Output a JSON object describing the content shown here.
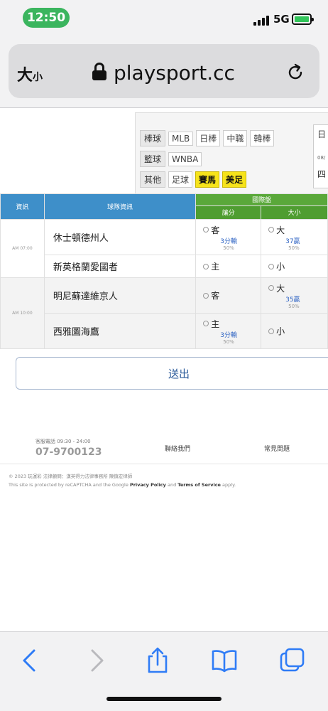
{
  "status": {
    "time": "12:50",
    "network": "5G"
  },
  "browser": {
    "text_size": "大",
    "text_size_small": "小",
    "url": "playsport.cc"
  },
  "filters": {
    "rows": [
      {
        "category": "棒球",
        "items": [
          {
            "label": "MLB",
            "active": false
          },
          {
            "label": "日棒",
            "active": false
          },
          {
            "label": "中職",
            "active": false
          },
          {
            "label": "韓棒",
            "active": false
          }
        ]
      },
      {
        "category": "籃球",
        "items": [
          {
            "label": "WNBA",
            "active": false
          }
        ]
      },
      {
        "category": "其他",
        "items": [
          {
            "label": "足球",
            "active": false
          },
          {
            "label": "賽馬",
            "active": true
          },
          {
            "label": "美足",
            "active": true
          }
        ]
      }
    ],
    "side_label": "日",
    "side_date": "08/",
    "side_day": "四"
  },
  "table": {
    "headers": {
      "info": "資訊",
      "teams": "球隊資訊",
      "market": "國際盤",
      "spread": "讓分",
      "total": "大小"
    },
    "games": [
      {
        "time": "AM 07:00",
        "away": {
          "team": "休士頓德州人",
          "spread_side": "客",
          "spread_odds": "3分輸",
          "spread_pct": "50%",
          "total_side": "大",
          "total_odds": "37贏",
          "total_pct": "50%"
        },
        "home": {
          "team": "新英格蘭愛國者",
          "spread_side": "主",
          "spread_odds": "",
          "spread_pct": "",
          "total_side": "小",
          "total_odds": "",
          "total_pct": ""
        }
      },
      {
        "time": "AM 10:00",
        "away": {
          "team": "明尼蘇達維京人",
          "spread_side": "客",
          "spread_odds": "",
          "spread_pct": "",
          "total_side": "大",
          "total_odds": "35贏",
          "total_pct": "50%"
        },
        "home": {
          "team": "西雅圖海鷹",
          "spread_side": "主",
          "spread_odds": "3分輸",
          "spread_pct": "50%",
          "total_side": "小",
          "total_odds": "",
          "total_pct": ""
        }
      }
    ]
  },
  "submit_label": "送出",
  "footer": {
    "hotline_label": "客服電話 09:30 - 24:00",
    "hotline_number": "07-9700123",
    "contact": "聯絡我們",
    "faq": "常見問題",
    "copyright": "© 2023 玩運彩  法律顧問：漢英得力法律事務所 陳鎮宏律師",
    "recaptcha_prefix": "This site is protected by reCAPTCHA and the Google",
    "privacy": "Privacy Policy",
    "and": "and",
    "terms": "Terms of Service",
    "apply": "apply."
  },
  "colors": {
    "header_blue": "#3e8fc9",
    "header_green": "#5aa83a",
    "highlight": "#f6e31a",
    "odds_blue": "#2c62c3",
    "time_pill": "#3bb55e"
  }
}
